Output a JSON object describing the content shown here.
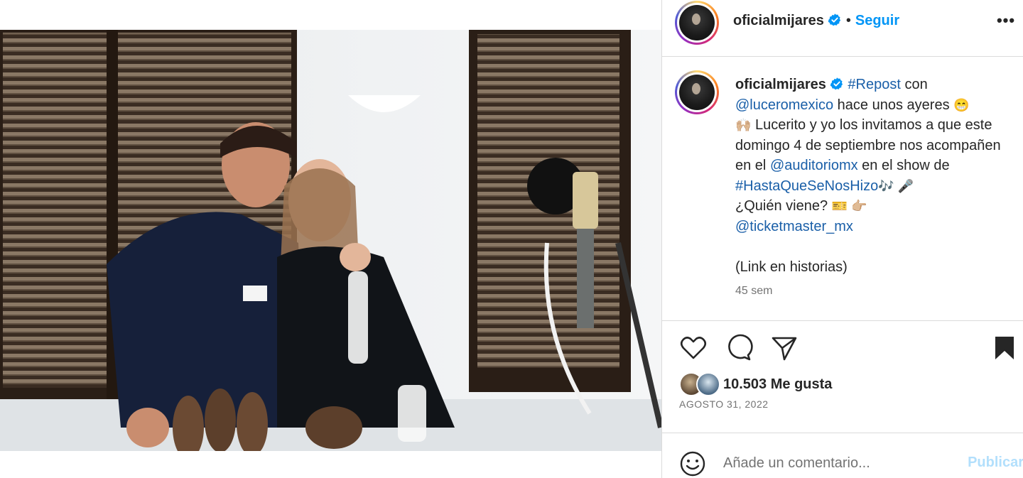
{
  "post": {
    "image_alt": "Foto en estudio de grabación",
    "username": "oficialmijares",
    "follow_label": "Seguir",
    "separator": "•",
    "more_label": "•••"
  },
  "caption": {
    "username": "oficialmijares",
    "parts": {
      "p1": "#Repost",
      "p2": " con ",
      "p3": "@luceromexico",
      "p4": " hace unos ayeres ",
      "p5": "😁",
      "p6": "🙌🏼",
      "p7": " Lucerito y yo los invitamos a que este domingo 4 de septiembre nos acompañen en el ",
      "p8": "@auditoriomx",
      "p9": " en el show de ",
      "p10": "#HastaQueSeNosHizo",
      "p11": " 🎶 🎤",
      "p12": "¿Quién viene? ",
      "p13": "🎫 👉🏼",
      "p14": "@ticketmaster_mx",
      "p15": "(Link en historias)"
    },
    "time_ago": "45 sem"
  },
  "actions": {
    "like_icon": "heart-icon",
    "comment_icon": "comment-icon",
    "share_icon": "send-icon",
    "save_icon": "bookmark-icon"
  },
  "likes": {
    "text": "10.503 Me gusta"
  },
  "date": "AGOSTO 31, 2022",
  "comment": {
    "placeholder": "Añade un comentario...",
    "publish_label": "Publicar",
    "emoji_icon": "smiley-icon"
  },
  "colors": {
    "accent": "#0095f6",
    "link": "#00376b",
    "publish_disabled": "#b2dffc",
    "muted": "#737373",
    "border": "#dbdbdb"
  }
}
